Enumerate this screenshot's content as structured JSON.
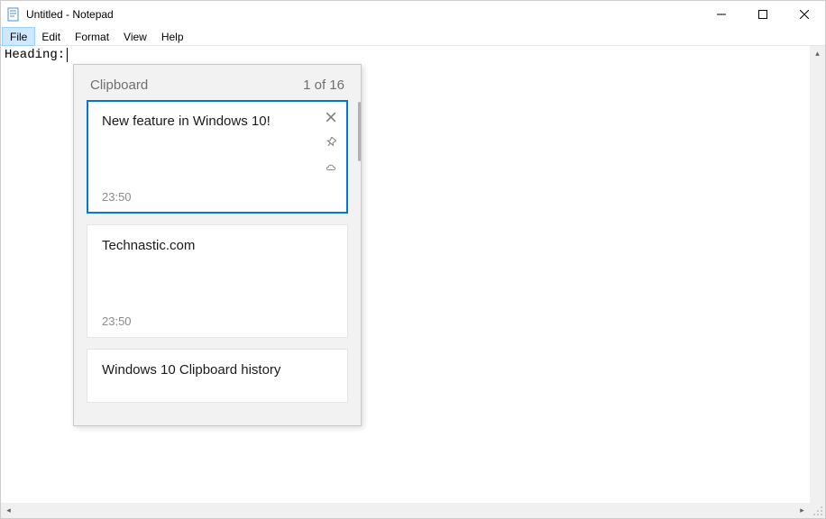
{
  "window": {
    "title": "Untitled - Notepad"
  },
  "menu": {
    "file": "File",
    "edit": "Edit",
    "format": "Format",
    "view": "View",
    "help": "Help"
  },
  "editor": {
    "content": "Heading:"
  },
  "clipboard": {
    "title": "Clipboard",
    "counter": "1 of 16",
    "items": [
      {
        "text": "New feature in Windows 10!",
        "time": "23:50",
        "selected": true
      },
      {
        "text": "Technastic.com",
        "time": "23:50",
        "selected": false
      },
      {
        "text": "Windows 10 Clipboard history",
        "time": "",
        "selected": false
      }
    ]
  }
}
